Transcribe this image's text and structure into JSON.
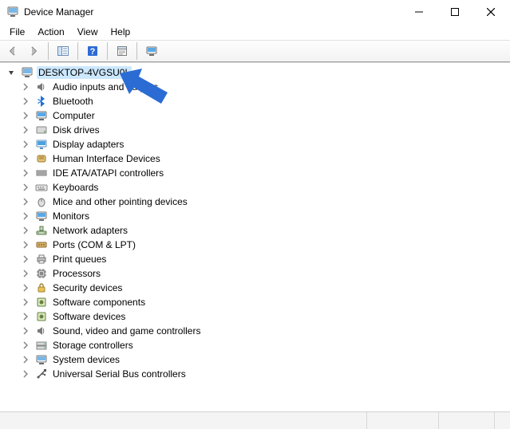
{
  "window": {
    "title": "Device Manager"
  },
  "menubar": {
    "items": [
      "File",
      "Action",
      "View",
      "Help"
    ]
  },
  "toolbar": {
    "back": "back-icon",
    "forward": "forward-icon",
    "showhide": "show-hide-console-tree-icon",
    "help": "help-icon",
    "properties": "properties-icon",
    "monitor": "scan-hardware-icon"
  },
  "tree": {
    "root": {
      "label": "DESKTOP-4VGSU0L",
      "expanded": true,
      "selected": true,
      "icon": "computer"
    },
    "children": [
      {
        "label": "Audio inputs and outputs",
        "icon": "speaker"
      },
      {
        "label": "Bluetooth",
        "icon": "bluetooth"
      },
      {
        "label": "Computer",
        "icon": "monitor"
      },
      {
        "label": "Disk drives",
        "icon": "drive"
      },
      {
        "label": "Display adapters",
        "icon": "display"
      },
      {
        "label": "Human Interface Devices",
        "icon": "hid"
      },
      {
        "label": "IDE ATA/ATAPI controllers",
        "icon": "ide"
      },
      {
        "label": "Keyboards",
        "icon": "keyboard"
      },
      {
        "label": "Mice and other pointing devices",
        "icon": "mouse"
      },
      {
        "label": "Monitors",
        "icon": "monitor"
      },
      {
        "label": "Network adapters",
        "icon": "network"
      },
      {
        "label": "Ports (COM & LPT)",
        "icon": "port"
      },
      {
        "label": "Print queues",
        "icon": "printer"
      },
      {
        "label": "Processors",
        "icon": "cpu"
      },
      {
        "label": "Security devices",
        "icon": "security"
      },
      {
        "label": "Software components",
        "icon": "software"
      },
      {
        "label": "Software devices",
        "icon": "software"
      },
      {
        "label": "Sound, video and game controllers",
        "icon": "speaker"
      },
      {
        "label": "Storage controllers",
        "icon": "storage"
      },
      {
        "label": "System devices",
        "icon": "system"
      },
      {
        "label": "Universal Serial Bus controllers",
        "icon": "usb"
      }
    ]
  },
  "colors": {
    "arrow": "#2B6CD4"
  }
}
